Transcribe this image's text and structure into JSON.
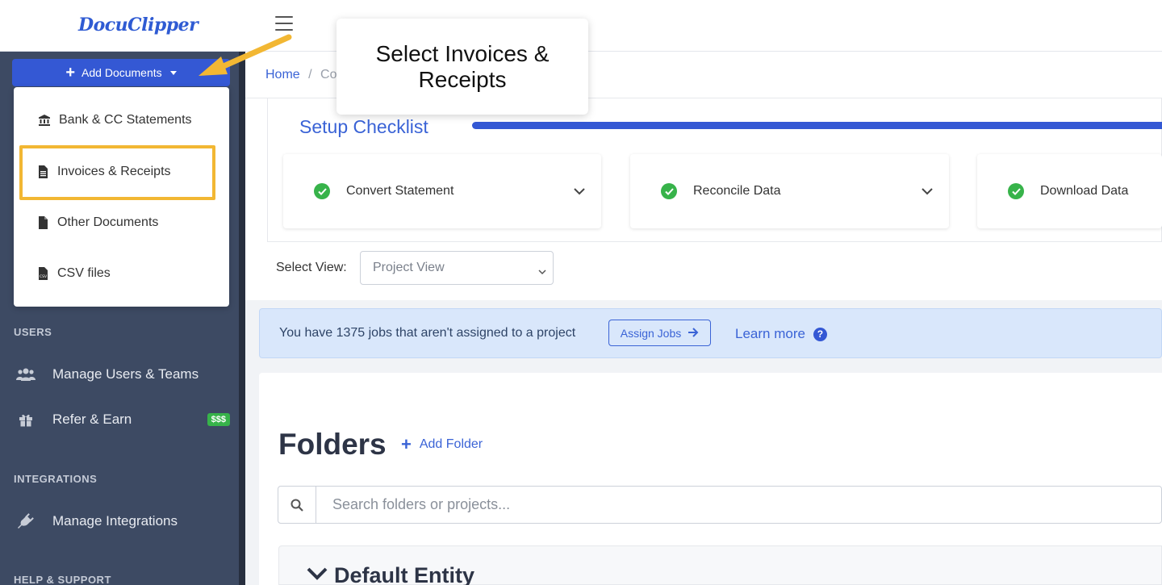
{
  "app": {
    "logo": "DocuClipper"
  },
  "sidebar": {
    "add_documents_label": "Add Documents",
    "dropdown": [
      {
        "label": "Bank & CC Statements",
        "icon": "bank-icon"
      },
      {
        "label": "Invoices & Receipts",
        "icon": "document-icon"
      },
      {
        "label": "Other Documents",
        "icon": "file-icon"
      },
      {
        "label": "CSV files",
        "icon": "csv-file-icon"
      }
    ],
    "users_heading": "USERS",
    "manage_users_label": "Manage Users & Teams",
    "refer_label": "Refer & Earn",
    "refer_badge": "$$$",
    "integrations_heading": "INTEGRATIONS",
    "manage_integrations_label": "Manage Integrations",
    "help_heading": "HELP & SUPPORT"
  },
  "breadcrumb": {
    "home": "Home",
    "separator": "/",
    "current": "Co"
  },
  "checklist": {
    "title": "Setup Checklist",
    "steps": [
      {
        "label": "Convert Statement",
        "done": true
      },
      {
        "label": "Reconcile Data",
        "done": true
      },
      {
        "label": "Download Data",
        "done": true
      }
    ]
  },
  "view": {
    "label": "Select View:",
    "selected": "Project View"
  },
  "alert": {
    "text": "You have 1375 jobs that aren't assigned to a project",
    "assign_label": "Assign Jobs",
    "learn_more_label": "Learn more"
  },
  "folders": {
    "title": "Folders",
    "add_folder_label": "Add Folder",
    "search_placeholder": "Search folders or projects...",
    "entity_title": "Default Entity"
  },
  "callout": {
    "text": "Select Invoices & Receipts"
  },
  "colors": {
    "primary": "#3458d4",
    "sidebar": "#3d4a63",
    "highlight": "#f2b733",
    "success": "#37b34a"
  }
}
